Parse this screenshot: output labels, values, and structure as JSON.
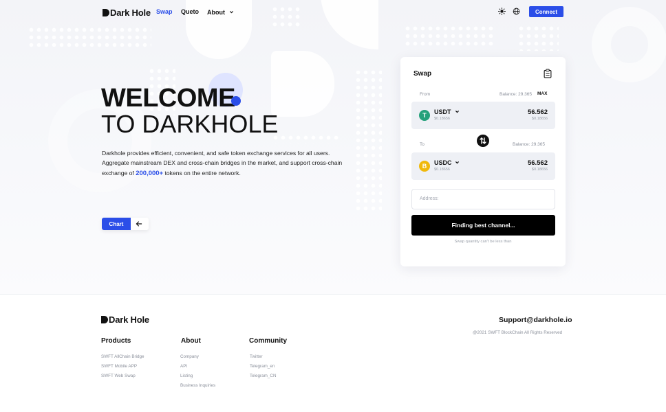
{
  "nav": {
    "logo": "Dark Hole",
    "links": [
      {
        "label": "Swap",
        "active": true
      },
      {
        "label": "Queto",
        "active": false
      },
      {
        "label": "About",
        "active": false
      }
    ],
    "icons": [
      "sun-icon",
      "globe-icon"
    ],
    "connect_label": "Connect"
  },
  "hero": {
    "line1": "WELCOME",
    "line2": "TO DARKHOLE",
    "desc_part1": "Darkhole provides efficient, convenient, and safe token exchange services for all users. Aggregate mainstream DEX and cross-chain bridges in the market, and support cross-chain exchange of",
    "desc_highlight": "200,000+",
    "desc_part2": "tokens on the entire network.",
    "chart_label": "Chart"
  },
  "swap": {
    "title": "Swap",
    "from_label": "From",
    "from_balance": "Balance: 29.365",
    "max_label": "MAX",
    "from_token": {
      "name": "USDT",
      "sub": "$0.18656",
      "amount": "56.562",
      "amount_sub": "$0.18656",
      "color": "#26a17b",
      "glyph": "T"
    },
    "to_label": "To",
    "to_balance": "Balance: 29.365",
    "to_token": {
      "name": "USDC",
      "sub": "$0.18656",
      "amount": "56.562",
      "amount_sub": "$0.18656",
      "color": "#f0b90b",
      "glyph": "B"
    },
    "address_placeholder": "Address:",
    "finding_label": "Finding best channel...",
    "hint": "Swap quantity can't be less than"
  },
  "footer": {
    "logo": "Dark Hole",
    "support": "Support@darkhole.io",
    "copyright": "@2021 SWFT BlockChain All Rights Reserved",
    "columns": [
      {
        "title": "Products",
        "links": [
          "SWFT AllChain Bridge",
          "SWFT Mobile APP",
          "SWFT Web Swap"
        ]
      },
      {
        "title": "About",
        "links": [
          "Company",
          "API",
          "Listing",
          "Business Inquiries"
        ]
      },
      {
        "title": "Community",
        "links": [
          "Twitter",
          "Telegram_en",
          "Telegram_CN"
        ]
      }
    ]
  },
  "colors": {
    "accent": "#2b4ee8",
    "usdt": "#26a17b",
    "usdc": "#f0b90b"
  }
}
